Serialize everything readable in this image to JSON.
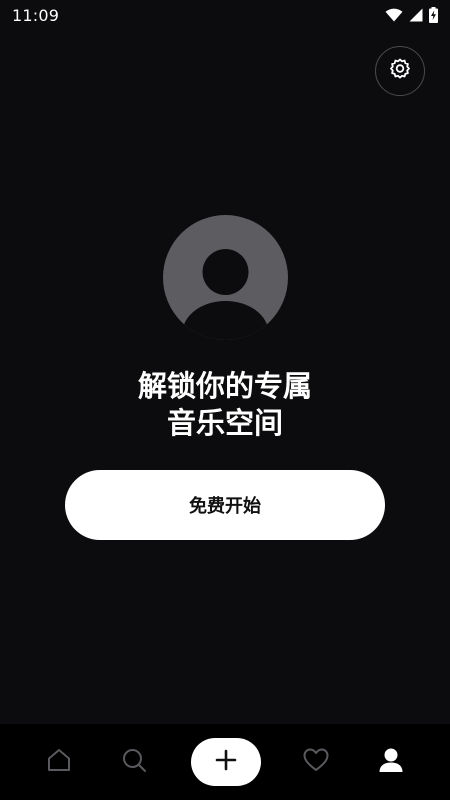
{
  "status_bar": {
    "time": "11:09",
    "icons": [
      "wifi-icon",
      "signal-icon",
      "battery-charging-icon"
    ]
  },
  "header": {
    "settings_icon": "gear-icon"
  },
  "profile": {
    "avatar_icon": "user-silhouette-icon",
    "headline_line1": "解锁你的专属",
    "headline_line2": "音乐空间"
  },
  "cta": {
    "start_label": "免费开始"
  },
  "bottom_nav": {
    "items": [
      {
        "icon": "home-icon",
        "active": false
      },
      {
        "icon": "search-icon",
        "active": false
      },
      {
        "icon": "plus-icon",
        "active": false
      },
      {
        "icon": "heart-icon",
        "active": false
      },
      {
        "icon": "profile-icon",
        "active": true
      }
    ]
  },
  "colors": {
    "background": "#0c0c0e",
    "avatar": "#5d5d61",
    "button": "#ffffff",
    "nav_inactive": "#5a5a5e",
    "nav_active": "#ffffff"
  }
}
